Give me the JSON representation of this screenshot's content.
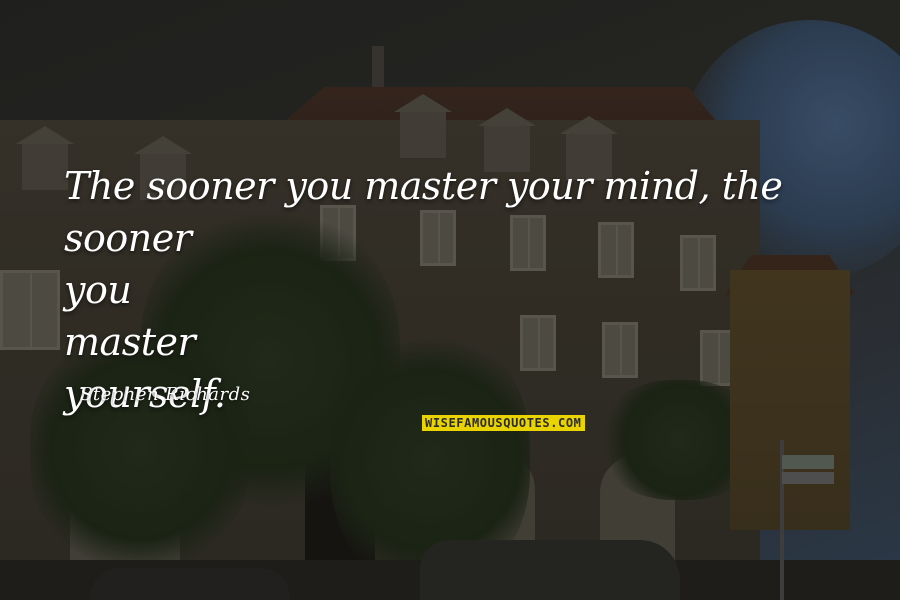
{
  "quote": {
    "lines": [
      "The sooner you master your mind, the sooner",
      "you",
      "master",
      "yourself."
    ]
  },
  "author": "Stephen Richards",
  "watermark": "WISEFAMOUSQUOTES.COM",
  "colors": {
    "text": "#ffffff",
    "badge_background": "#e9d300",
    "badge_text": "#2c2c2c"
  }
}
